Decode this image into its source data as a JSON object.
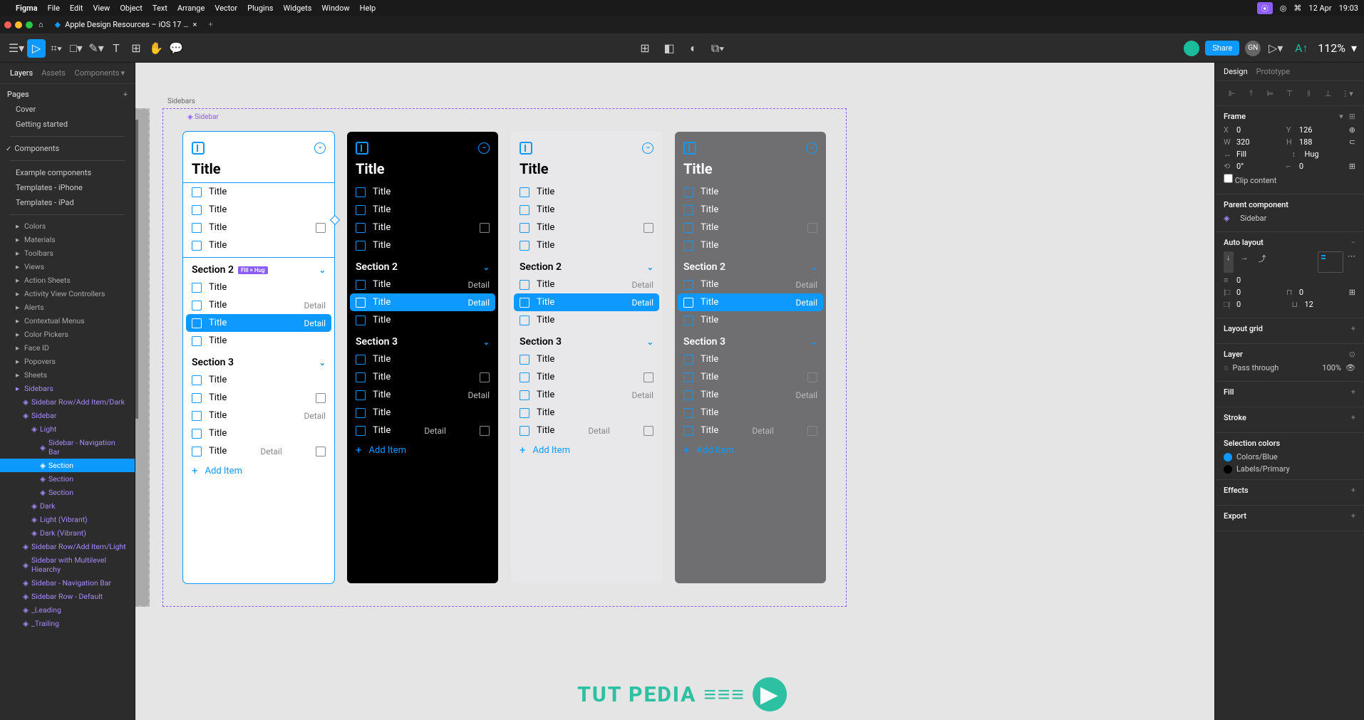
{
  "menubar": {
    "app": "Figma",
    "items": [
      "File",
      "Edit",
      "View",
      "Object",
      "Text",
      "Arrange",
      "Vector",
      "Plugins",
      "Widgets",
      "Window",
      "Help"
    ],
    "date": "12 Apr",
    "time": "19:03"
  },
  "tabs": {
    "home_icon": "🏠",
    "active_tab": "Apple Design Resources – iOS 17 …",
    "close": "×",
    "plus": "+"
  },
  "toolbar": {
    "share": "Share",
    "zoom": "112%",
    "avatar2_label": "GN"
  },
  "left": {
    "tabs": {
      "layers": "Layers",
      "assets": "Assets",
      "components": "Components"
    },
    "pages_header": "Pages",
    "pages": [
      "Cover",
      "Getting started",
      "Components",
      "Example components",
      "Templates - iPhone",
      "Templates - iPad"
    ],
    "pages_sep_after": [
      1,
      2
    ],
    "checked_page_index": 2,
    "layers_top": [
      "Colors",
      "Materials",
      "Toolbars",
      "Views",
      "Action Sheets",
      "Activity View Controllers",
      "Alerts",
      "Contextual Menus",
      "Color Pickers",
      "Face ID",
      "Popovers",
      "Sheets",
      "Sidebars"
    ],
    "layers_tree": [
      {
        "label": "Sidebar Row/Add Item/Dark",
        "cls": "purple indent1"
      },
      {
        "label": "Sidebar",
        "cls": "purple indent1"
      },
      {
        "label": "Light",
        "cls": "purple indent2"
      },
      {
        "label": "Sidebar - Navigation Bar",
        "cls": "purple indent3"
      },
      {
        "label": "Section",
        "cls": "indent3 sel"
      },
      {
        "label": "Section",
        "cls": "purple indent3"
      },
      {
        "label": "Section",
        "cls": "purple indent3"
      },
      {
        "label": "Dark",
        "cls": "purple indent2"
      },
      {
        "label": "Light (Vibrant)",
        "cls": "purple indent2"
      },
      {
        "label": "Dark (Vibrant)",
        "cls": "purple indent2"
      },
      {
        "label": "Sidebar Row/Add Item/Light",
        "cls": "purple indent1"
      },
      {
        "label": "Sidebar with Multilevel Hiearchy",
        "cls": "purple indent1"
      },
      {
        "label": "Sidebar - Navigation Bar",
        "cls": "purple indent1"
      },
      {
        "label": "Sidebar Row - Default",
        "cls": "purple indent1"
      },
      {
        "label": "_Leading",
        "cls": "purple indent1"
      },
      {
        "label": "_Trailing",
        "cls": "purple indent1"
      }
    ]
  },
  "canvas": {
    "frame_label": "Sidebars",
    "sidebar_label": "◈ Sidebar",
    "selection_badge": "Fill × Hug",
    "cards": [
      {
        "theme": "light",
        "selected": true
      },
      {
        "theme": "dark"
      },
      {
        "theme": "grey-light"
      },
      {
        "theme": "grey-dark"
      }
    ],
    "card_title": "Title",
    "row_label": "Title",
    "detail": "Detail",
    "section2": "Section 2",
    "section3": "Section 3",
    "add_item": "Add Item"
  },
  "right": {
    "tabs": {
      "design": "Design",
      "prototype": "Prototype"
    },
    "frame": {
      "header": "Frame",
      "x": "0",
      "y": "126",
      "w": "320",
      "h": "188",
      "w_mode": "Fill",
      "h_mode": "Hug",
      "rot": "0°",
      "rad": "0",
      "clip": "Clip content"
    },
    "parent": {
      "header": "Parent component",
      "name": "Sidebar"
    },
    "al": {
      "header": "Auto layout",
      "gap": "0",
      "ph": "0",
      "pv1": "0",
      "pv2": "12"
    },
    "grid": "Layout grid",
    "layer": {
      "header": "Layer",
      "blend": "Pass through",
      "opacity": "100%"
    },
    "fill": "Fill",
    "stroke": "Stroke",
    "selcolors": {
      "header": "Selection colors",
      "c1": "Colors/Blue",
      "c2": "Labels/Primary",
      "c1_hex": "#0d99ff",
      "c2_hex": "#000000"
    },
    "effects": "Effects",
    "export": "Export"
  },
  "watermark": "TUT PEDIA"
}
